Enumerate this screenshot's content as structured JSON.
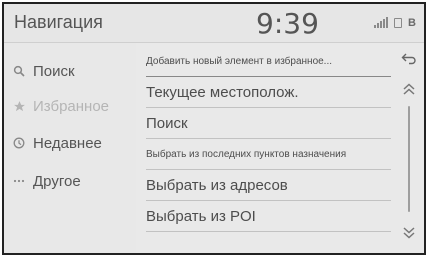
{
  "header": {
    "title": "Навигация",
    "time": "9:39",
    "status_icons": [
      "signal-icon",
      "sd-card-icon",
      "bluetooth-icon"
    ],
    "bluetooth_glyph": "B"
  },
  "sidebar": {
    "items": [
      {
        "label": "Поиск",
        "icon": "search-icon",
        "selected": false
      },
      {
        "label": "Избранное",
        "icon": "star-icon",
        "selected": true
      },
      {
        "label": "Недавнее",
        "icon": "clock-icon",
        "selected": false
      },
      {
        "label": "Другое",
        "icon": "more-icon",
        "selected": false
      }
    ]
  },
  "list": {
    "items": [
      {
        "label": "Добавить новый элемент в избранное..."
      },
      {
        "label": "Текущее местополож."
      },
      {
        "label": "Поиск"
      },
      {
        "label": "Выбрать из последних пунктов назначения"
      },
      {
        "label": "Выбрать из адресов"
      },
      {
        "label": "Выбрать из POI"
      }
    ]
  },
  "controls": {
    "back_icon": "back-arrow-icon",
    "scroll_up_icon": "double-chevron-up-icon",
    "scroll_down_icon": "double-chevron-down-icon"
  },
  "colors": {
    "background": "#e9e9e9",
    "text": "#4d4d4d",
    "selected_text": "#b5b5b5",
    "divider": "#c2c2c2"
  }
}
